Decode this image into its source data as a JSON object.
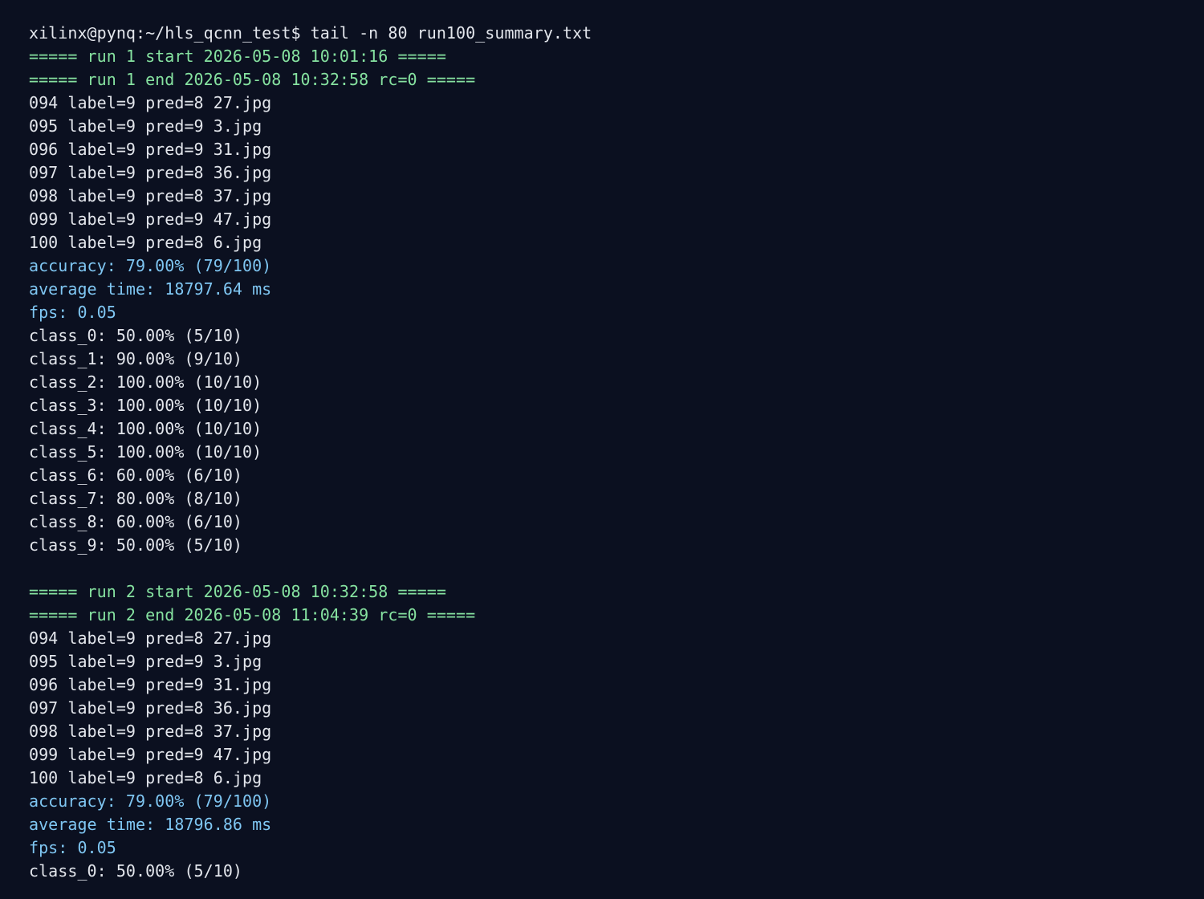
{
  "terminal": {
    "colors": {
      "background": "#0b1020",
      "default": "#e3e6ec",
      "header": "#86e2a0",
      "stat": "#7fc6f2"
    },
    "lines": [
      {
        "text": "xilinx@pynq:~/hls_qcnn_test$ tail -n 80 run100_summary.txt",
        "kind": "default"
      },
      {
        "text": "===== run 1 start 2026-05-08 10:01:16 =====",
        "kind": "header"
      },
      {
        "text": "===== run 1 end 2026-05-08 10:32:58 rc=0 =====",
        "kind": "header"
      },
      {
        "text": "094 label=9 pred=8 27.jpg",
        "kind": "default"
      },
      {
        "text": "095 label=9 pred=9 3.jpg",
        "kind": "default"
      },
      {
        "text": "096 label=9 pred=9 31.jpg",
        "kind": "default"
      },
      {
        "text": "097 label=9 pred=8 36.jpg",
        "kind": "default"
      },
      {
        "text": "098 label=9 pred=8 37.jpg",
        "kind": "default"
      },
      {
        "text": "099 label=9 pred=9 47.jpg",
        "kind": "default"
      },
      {
        "text": "100 label=9 pred=8 6.jpg",
        "kind": "default"
      },
      {
        "text": "accuracy: 79.00% (79/100)",
        "kind": "stat"
      },
      {
        "text": "average time: 18797.64 ms",
        "kind": "stat"
      },
      {
        "text": "fps: 0.05",
        "kind": "stat"
      },
      {
        "text": "class_0: 50.00% (5/10)",
        "kind": "default"
      },
      {
        "text": "class_1: 90.00% (9/10)",
        "kind": "default"
      },
      {
        "text": "class_2: 100.00% (10/10)",
        "kind": "default"
      },
      {
        "text": "class_3: 100.00% (10/10)",
        "kind": "default"
      },
      {
        "text": "class_4: 100.00% (10/10)",
        "kind": "default"
      },
      {
        "text": "class_5: 100.00% (10/10)",
        "kind": "default"
      },
      {
        "text": "class_6: 60.00% (6/10)",
        "kind": "default"
      },
      {
        "text": "class_7: 80.00% (8/10)",
        "kind": "default"
      },
      {
        "text": "class_8: 60.00% (6/10)",
        "kind": "default"
      },
      {
        "text": "class_9: 50.00% (5/10)",
        "kind": "default"
      },
      {
        "text": "",
        "kind": "default"
      },
      {
        "text": "===== run 2 start 2026-05-08 10:32:58 =====",
        "kind": "header"
      },
      {
        "text": "===== run 2 end 2026-05-08 11:04:39 rc=0 =====",
        "kind": "header"
      },
      {
        "text": "094 label=9 pred=8 27.jpg",
        "kind": "default"
      },
      {
        "text": "095 label=9 pred=9 3.jpg",
        "kind": "default"
      },
      {
        "text": "096 label=9 pred=9 31.jpg",
        "kind": "default"
      },
      {
        "text": "097 label=9 pred=8 36.jpg",
        "kind": "default"
      },
      {
        "text": "098 label=9 pred=8 37.jpg",
        "kind": "default"
      },
      {
        "text": "099 label=9 pred=9 47.jpg",
        "kind": "default"
      },
      {
        "text": "100 label=9 pred=8 6.jpg",
        "kind": "default"
      },
      {
        "text": "accuracy: 79.00% (79/100)",
        "kind": "stat"
      },
      {
        "text": "average time: 18796.86 ms",
        "kind": "stat"
      },
      {
        "text": "fps: 0.05",
        "kind": "stat"
      },
      {
        "text": "class_0: 50.00% (5/10)",
        "kind": "default"
      }
    ]
  }
}
